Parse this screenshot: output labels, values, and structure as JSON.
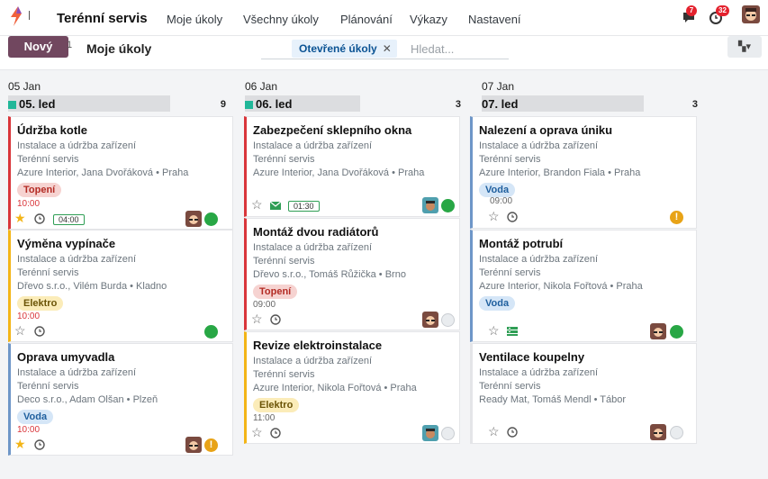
{
  "navbar": {
    "app_name": "Terénní servis",
    "menu": [
      "Moje úkoly",
      "Všechny úkoly",
      "Plánování",
      "Výkazy",
      "Nastavení"
    ],
    "messages_count": "7",
    "activities_count": "32"
  },
  "control": {
    "new_label": "Nový",
    "new_tail": "1",
    "breadcrumb": "Moje úkoly",
    "facet": "Otevřené úkoly",
    "search_placeholder": "Hledat..."
  },
  "columns": [
    {
      "date_small": "05 Jan",
      "title": "05. led",
      "count": "9",
      "cards": [
        {
          "title": "Údržba kotle",
          "project": "Instalace a údržba zařízení",
          "team": "Terénní servis",
          "customer": "Azure Interior, Jana Dvořáková • Praha",
          "tag": "Topení",
          "time": "10:00",
          "timer": "04:00"
        },
        {
          "title": "Výměna vypínače",
          "project": "Instalace a údržba zařízení",
          "team": "Terénní servis",
          "customer": "Dřevo s.r.o., Vilém Burda • Kladno",
          "tag": "Elektro",
          "time": "10:00"
        },
        {
          "title": "Oprava umyvadla",
          "project": "Instalace a údržba zařízení",
          "team": "Terénní servis",
          "customer": "Deco s.r.o., Adam Olšan • Plzeň",
          "tag": "Voda",
          "time": "10:00"
        }
      ]
    },
    {
      "date_small": "06 Jan",
      "title": "06. led",
      "count": "3",
      "cards": [
        {
          "title": "Zabezpečení sklepního okna",
          "project": "Instalace a údržba zařízení",
          "team": "Terénní servis",
          "customer": "Azure Interior, Jana Dvořáková • Praha",
          "timer": "01:30"
        },
        {
          "title": "Montáž dvou radiátorů",
          "project": "Instalace a údržba zařízení",
          "team": "Terénní servis",
          "customer": "Dřevo s.r.o., Tomáš Růžička • Brno",
          "tag": "Topení",
          "time": "09:00"
        },
        {
          "title": "Revize elektroinstalace",
          "project": "Instalace a údržba zařízení",
          "team": "Terénní servis",
          "customer": "Azure Interior, Nikola Fořtová • Praha",
          "tag": "Elektro",
          "time": "11:00"
        }
      ]
    },
    {
      "date_small": "07 Jan",
      "title": "07. led",
      "count": "3",
      "cards": [
        {
          "title": "Nalezení a oprava úniku",
          "project": "Instalace a údržba zařízení",
          "team": "Terénní servis",
          "customer": "Azure Interior, Brandon Fiala • Praha",
          "tag": "Voda",
          "time": "09:00"
        },
        {
          "title": "Montáž potrubí",
          "project": "Instalace a údržba zařízení",
          "team": "Terénní servis",
          "customer": "Azure Interior, Nikola Fořtová • Praha",
          "tag": "Voda"
        },
        {
          "title": "Ventilace koupelny",
          "project": "Instalace a údržba zařízení",
          "team": "Terénní servis",
          "customer": "Ready Mat, Tomáš Mendl • Tábor"
        }
      ]
    }
  ],
  "colors": {
    "brand": "#71475f",
    "done": "#28a745",
    "warning": "#e8a317",
    "priority_star": "#f3b517"
  }
}
